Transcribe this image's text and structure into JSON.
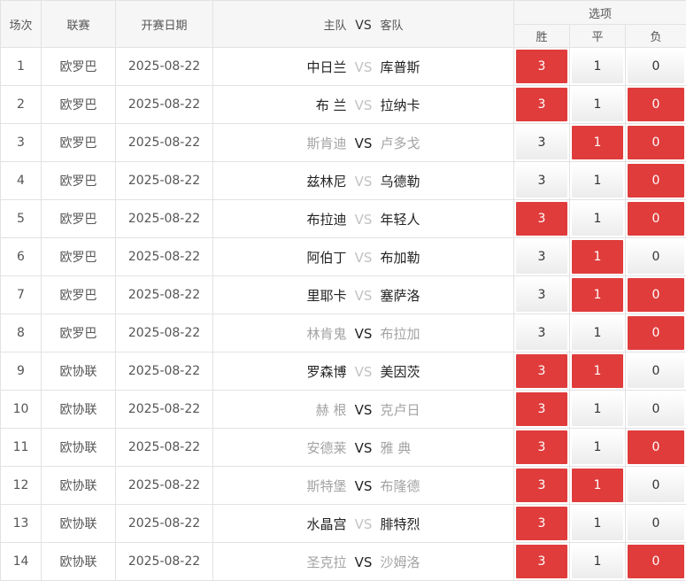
{
  "header": {
    "no": "场次",
    "league": "联赛",
    "date": "开赛日期",
    "home": "主队",
    "vs": "VS",
    "away": "客队",
    "options": "选项",
    "win": "胜",
    "draw": "平",
    "lose": "负"
  },
  "colors": {
    "selected": "#e03c3c",
    "border": "#e2e2e2",
    "header_bg": "#f6f6f6"
  },
  "rows": [
    {
      "no": "1",
      "league": "欧罗巴",
      "date": "2025-08-22",
      "home": "中日兰",
      "vs": "VS",
      "away": "库普斯",
      "home_dark": true,
      "away_dark": true,
      "vs_dark": false,
      "win": "3",
      "draw": "1",
      "lose": "0",
      "win_sel": true,
      "draw_sel": false,
      "lose_sel": false
    },
    {
      "no": "2",
      "league": "欧罗巴",
      "date": "2025-08-22",
      "home": "布 兰",
      "vs": "VS",
      "away": "拉纳卡",
      "home_dark": true,
      "away_dark": true,
      "vs_dark": false,
      "win": "3",
      "draw": "1",
      "lose": "0",
      "win_sel": true,
      "draw_sel": false,
      "lose_sel": true
    },
    {
      "no": "3",
      "league": "欧罗巴",
      "date": "2025-08-22",
      "home": "斯肯迪",
      "vs": "VS",
      "away": "卢多戈",
      "home_dark": false,
      "away_dark": false,
      "vs_dark": true,
      "win": "3",
      "draw": "1",
      "lose": "0",
      "win_sel": false,
      "draw_sel": true,
      "lose_sel": true
    },
    {
      "no": "4",
      "league": "欧罗巴",
      "date": "2025-08-22",
      "home": "兹林尼",
      "vs": "VS",
      "away": "乌德勒",
      "home_dark": true,
      "away_dark": true,
      "vs_dark": false,
      "win": "3",
      "draw": "1",
      "lose": "0",
      "win_sel": false,
      "draw_sel": false,
      "lose_sel": true
    },
    {
      "no": "5",
      "league": "欧罗巴",
      "date": "2025-08-22",
      "home": "布拉迪",
      "vs": "VS",
      "away": "年轻人",
      "home_dark": true,
      "away_dark": true,
      "vs_dark": false,
      "win": "3",
      "draw": "1",
      "lose": "0",
      "win_sel": true,
      "draw_sel": false,
      "lose_sel": true
    },
    {
      "no": "6",
      "league": "欧罗巴",
      "date": "2025-08-22",
      "home": "阿伯丁",
      "vs": "VS",
      "away": "布加勒",
      "home_dark": true,
      "away_dark": true,
      "vs_dark": false,
      "win": "3",
      "draw": "1",
      "lose": "0",
      "win_sel": false,
      "draw_sel": true,
      "lose_sel": false
    },
    {
      "no": "7",
      "league": "欧罗巴",
      "date": "2025-08-22",
      "home": "里耶卡",
      "vs": "VS",
      "away": "塞萨洛",
      "home_dark": true,
      "away_dark": true,
      "vs_dark": false,
      "win": "3",
      "draw": "1",
      "lose": "0",
      "win_sel": false,
      "draw_sel": true,
      "lose_sel": true
    },
    {
      "no": "8",
      "league": "欧罗巴",
      "date": "2025-08-22",
      "home": "林肯鬼",
      "vs": "VS",
      "away": "布拉加",
      "home_dark": false,
      "away_dark": false,
      "vs_dark": true,
      "win": "3",
      "draw": "1",
      "lose": "0",
      "win_sel": false,
      "draw_sel": false,
      "lose_sel": true
    },
    {
      "no": "9",
      "league": "欧协联",
      "date": "2025-08-22",
      "home": "罗森博",
      "vs": "VS",
      "away": "美因茨",
      "home_dark": true,
      "away_dark": true,
      "vs_dark": false,
      "win": "3",
      "draw": "1",
      "lose": "0",
      "win_sel": true,
      "draw_sel": true,
      "lose_sel": false
    },
    {
      "no": "10",
      "league": "欧协联",
      "date": "2025-08-22",
      "home": "赫 根",
      "vs": "VS",
      "away": "克卢日",
      "home_dark": false,
      "away_dark": false,
      "vs_dark": true,
      "win": "3",
      "draw": "1",
      "lose": "0",
      "win_sel": true,
      "draw_sel": false,
      "lose_sel": false
    },
    {
      "no": "11",
      "league": "欧协联",
      "date": "2025-08-22",
      "home": "安德莱",
      "vs": "VS",
      "away": "雅 典",
      "home_dark": false,
      "away_dark": false,
      "vs_dark": true,
      "win": "3",
      "draw": "1",
      "lose": "0",
      "win_sel": true,
      "draw_sel": false,
      "lose_sel": true
    },
    {
      "no": "12",
      "league": "欧协联",
      "date": "2025-08-22",
      "home": "斯特堡",
      "vs": "VS",
      "away": "布隆德",
      "home_dark": false,
      "away_dark": false,
      "vs_dark": true,
      "win": "3",
      "draw": "1",
      "lose": "0",
      "win_sel": true,
      "draw_sel": true,
      "lose_sel": false
    },
    {
      "no": "13",
      "league": "欧协联",
      "date": "2025-08-22",
      "home": "水晶宫",
      "vs": "VS",
      "away": "腓特烈",
      "home_dark": true,
      "away_dark": true,
      "vs_dark": false,
      "win": "3",
      "draw": "1",
      "lose": "0",
      "win_sel": true,
      "draw_sel": false,
      "lose_sel": false
    },
    {
      "no": "14",
      "league": "欧协联",
      "date": "2025-08-22",
      "home": "圣克拉",
      "vs": "VS",
      "away": "沙姆洛",
      "home_dark": false,
      "away_dark": false,
      "vs_dark": true,
      "win": "3",
      "draw": "1",
      "lose": "0",
      "win_sel": true,
      "draw_sel": false,
      "lose_sel": true
    }
  ]
}
